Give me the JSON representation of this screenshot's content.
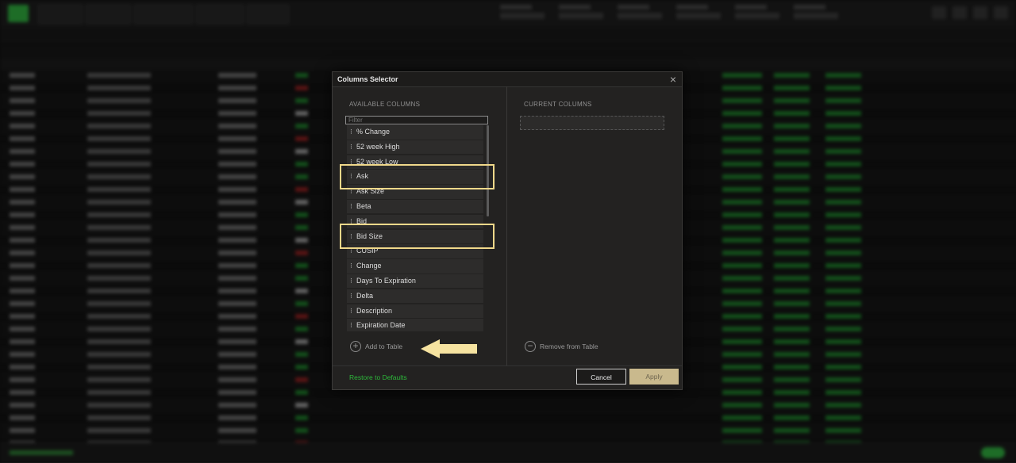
{
  "dialog": {
    "title": "Columns Selector",
    "available_label": "AVAILABLE COLUMNS",
    "current_label": "CURRENT COLUMNS",
    "filter_placeholder": "Filter",
    "available_columns": [
      "% Change",
      "52 week High",
      "52 week Low",
      "Ask",
      "Ask Size",
      "Beta",
      "Bid",
      "Bid Size",
      "CUSIP",
      "Change",
      "Days To Expiration",
      "Delta",
      "Description",
      "Expiration Date"
    ],
    "highlighted": [
      "Ask",
      "Bid Size"
    ],
    "add_label": "Add to Table",
    "remove_label": "Remove from Table",
    "restore_label": "Restore to Defaults",
    "cancel_label": "Cancel",
    "apply_label": "Apply"
  },
  "colors": {
    "accent_green": "#2db83a",
    "highlight": "#f0d88a",
    "apply_button": "#c9b98d"
  },
  "icons": {
    "close": "close-icon",
    "add": "plus-circle-icon",
    "remove": "minus-circle-icon",
    "grip": "drag-handle-icon",
    "annotation": "arrow-left-icon"
  }
}
